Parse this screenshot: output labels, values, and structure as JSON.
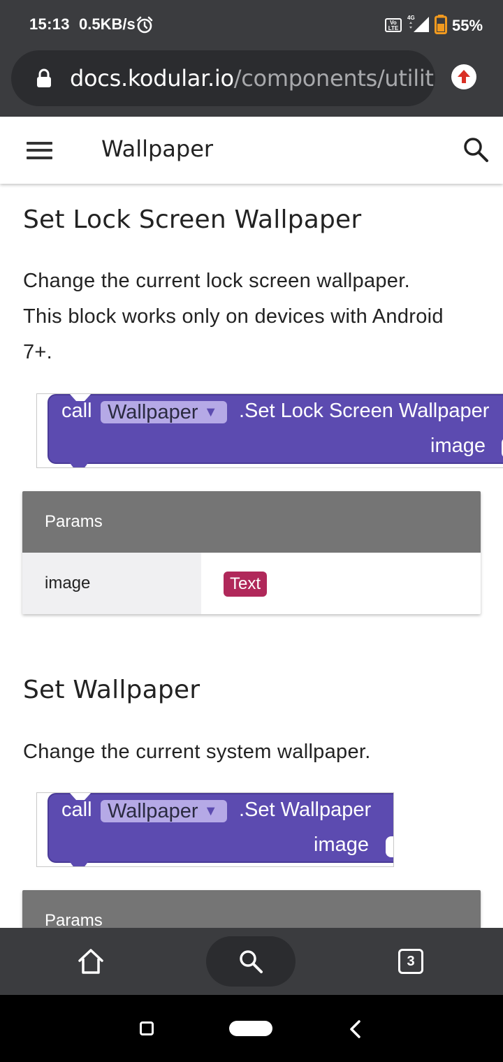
{
  "status_bar": {
    "time": "15:13",
    "speed": "0.5KB/s",
    "volte_label": "Vo LTE",
    "network": "4G",
    "battery_percent": "55%",
    "icons": [
      "alarm-icon",
      "volte-icon",
      "signal-icon",
      "battery-icon"
    ]
  },
  "browser": {
    "url_domain": "docs.kodular.io",
    "url_path": "/components/utilitie",
    "icons": [
      "lock-icon",
      "update-icon"
    ],
    "update_color": "#d93025"
  },
  "header": {
    "title": "Wallpaper",
    "icons": [
      "menu-icon",
      "search-icon"
    ]
  },
  "sections": [
    {
      "heading": "Set Lock Screen Wallpaper",
      "description_line1": "Change the current lock screen wallpaper.",
      "description_line2": "This block works only on devices with Android",
      "description_line3": "7+.",
      "block": {
        "call": "call",
        "component": "Wallpaper",
        "caret": "▼",
        "method": ".Set Lock Screen Wallpaper",
        "param": "image"
      },
      "params": {
        "header": "Params",
        "rows": [
          {
            "name": "image",
            "type": "Text"
          }
        ]
      }
    },
    {
      "heading": "Set Wallpaper",
      "description_line1": "Change the current system wallpaper.",
      "block": {
        "call": "call",
        "component": "Wallpaper",
        "caret": "▼",
        "method": ".Set Wallpaper",
        "param": "image"
      },
      "params": {
        "header": "Params"
      }
    }
  ],
  "bottom_toolbar": {
    "tab_count": "3",
    "icons": [
      "home-icon",
      "search-icon",
      "tabs-icon"
    ]
  },
  "nav_bar": {
    "icons": [
      "recent-apps-icon",
      "home-pill-icon",
      "back-icon"
    ]
  },
  "colors": {
    "block_purple": "#5c4bb0",
    "chip_lavender": "#b5a9e6",
    "type_badge": "#b0285a",
    "params_header": "#757575",
    "chrome_dark": "#3b3c3f"
  }
}
